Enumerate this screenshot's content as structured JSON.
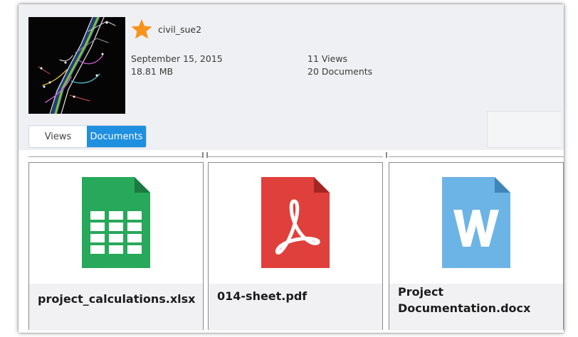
{
  "owner": {
    "username": "civil_sue2",
    "favorite_icon": "star-icon",
    "favorite_color": "#f7941d"
  },
  "stats": {
    "date": "September 15, 2015",
    "size": "18.81 MB",
    "views": "11 Views",
    "documents": "20 Documents"
  },
  "toggle": {
    "views_label": "Views",
    "documents_label": "Documents",
    "active": "Documents",
    "active_color": "#1f8fe0"
  },
  "documents": [
    {
      "name": "project_calculations.xlsx",
      "icon": "spreadsheet-file-icon",
      "color": "#27a85a"
    },
    {
      "name": "014-sheet.pdf",
      "icon": "pdf-file-icon",
      "color": "#e0403b"
    },
    {
      "name": "Project Documentation.docx",
      "icon": "word-file-icon",
      "color": "#6cb4e6"
    }
  ]
}
